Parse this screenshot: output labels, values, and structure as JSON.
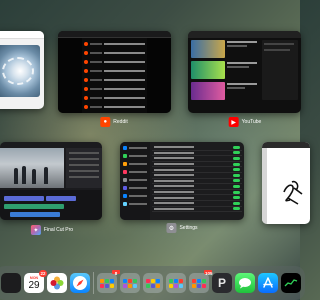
{
  "app_switcher": {
    "apps": [
      {
        "name": "",
        "icon": "photos-icon"
      },
      {
        "name": "Reddit",
        "icon": "reddit-icon",
        "color": "#ff4500"
      },
      {
        "name": "YouTube",
        "icon": "youtube-icon",
        "color": "#ff0000"
      },
      {
        "name": "Final Cut Pro",
        "icon": "final-cut-pro-icon"
      },
      {
        "name": "Settings",
        "icon": "gear-icon",
        "color": "#8e8e93"
      },
      {
        "name": "",
        "icon": "drawing-app-icon"
      }
    ]
  },
  "dock": {
    "items": [
      {
        "name": "calendar-app",
        "icon": "calendar-icon",
        "day": "29",
        "weekday": "MON",
        "badge": "22"
      },
      {
        "name": "photos-app",
        "icon": "photos-icon"
      },
      {
        "name": "safari-app",
        "icon": "safari-icon"
      },
      {
        "name": "folder-1",
        "icon": "folder-icon",
        "badge": "8"
      },
      {
        "name": "folder-2",
        "icon": "folder-icon"
      },
      {
        "name": "folder-3",
        "icon": "folder-icon"
      },
      {
        "name": "folder-4",
        "icon": "folder-icon"
      },
      {
        "name": "folder-5",
        "icon": "folder-icon",
        "badge": "105"
      },
      {
        "name": "pixelmator-app",
        "icon": "pixelmator-icon",
        "glyph": "P"
      },
      {
        "name": "messages-app",
        "icon": "messages-icon"
      },
      {
        "name": "app-store-app",
        "icon": "app-store-icon"
      },
      {
        "name": "stocks-app",
        "icon": "stocks-icon"
      }
    ]
  }
}
